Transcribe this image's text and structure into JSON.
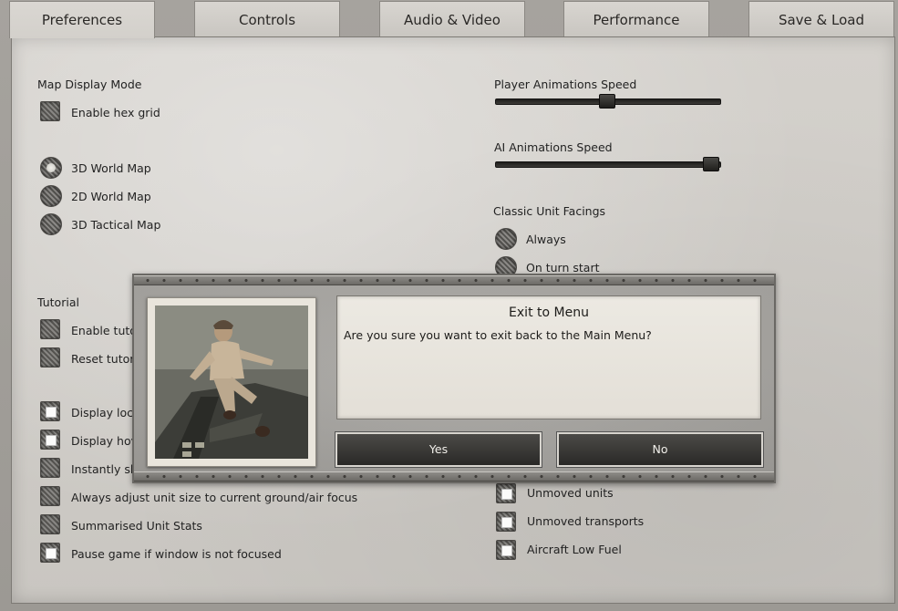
{
  "tabs": [
    "Preferences",
    "Controls",
    "Audio & Video",
    "Performance",
    "Save & Load"
  ],
  "active_tab": "Preferences",
  "left": {
    "map_display_mode": "Map Display Mode",
    "enable_hex_grid": {
      "label": "Enable hex grid",
      "checked": false
    },
    "map_modes": [
      {
        "label": "3D World Map",
        "selected": true
      },
      {
        "label": "2D World Map",
        "selected": false
      },
      {
        "label": "3D Tactical Map",
        "selected": false
      }
    ],
    "tutorial": "Tutorial",
    "tutorial_items": [
      {
        "label": "Enable tuto",
        "checked": false
      },
      {
        "label": "Reset tutori",
        "checked": false
      }
    ],
    "display_items": [
      {
        "label": "Display loca",
        "checked": true
      },
      {
        "label": "Display hov",
        "checked": true
      },
      {
        "label": "Instantly sh",
        "checked": false
      },
      {
        "label": "Always adjust unit size to current ground/air focus",
        "checked": false
      },
      {
        "label": "Summarised Unit Stats",
        "checked": false
      },
      {
        "label": "Pause game if window is not focused",
        "checked": true
      }
    ]
  },
  "right": {
    "player_anim": {
      "label": "Player Animations Speed",
      "value": 0.5
    },
    "ai_anim": {
      "label": "AI Animations Speed",
      "value": 1.0
    },
    "classic_facings": "Classic Unit Facings",
    "facing_options": [
      {
        "label": "Always",
        "selected": false
      },
      {
        "label": "On turn start",
        "selected": false
      }
    ],
    "alert_items": [
      {
        "label": "Unmoved units",
        "checked": true
      },
      {
        "label": "Unmoved transports",
        "checked": true
      },
      {
        "label": "Aircraft Low Fuel",
        "checked": true
      }
    ]
  },
  "dialog": {
    "title": "Exit to Menu",
    "message": "Are you sure you want to exit back to the Main Menu?",
    "yes": "Yes",
    "no": "No"
  }
}
